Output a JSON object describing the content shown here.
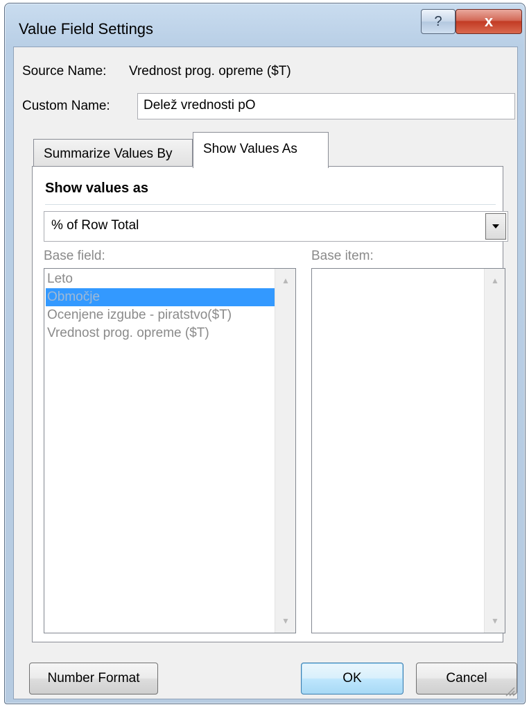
{
  "window": {
    "title": "Value Field Settings",
    "help_glyph": "?",
    "close_glyph": "x"
  },
  "source": {
    "label": "Source Name:",
    "value": "Vrednost prog. opreme ($T)"
  },
  "custom": {
    "label": "Custom Name:",
    "value": "Delež vrednosti pO"
  },
  "tabs": [
    {
      "label": "Summarize Values By",
      "active": false
    },
    {
      "label": "Show Values As",
      "active": true
    }
  ],
  "panel": {
    "section_title": "Show values as",
    "show_values_selected": "% of Row Total",
    "base_field_label": "Base field:",
    "base_item_label": "Base item:",
    "base_fields": [
      "Leto",
      "Območje",
      "Ocenjene izgube - piratstvo($T)",
      "Vrednost prog. opreme ($T)"
    ],
    "base_field_selected": "Območje",
    "base_items": []
  },
  "buttons": {
    "number_format": "Number Format",
    "ok": "OK",
    "cancel": "Cancel"
  },
  "icons": {
    "help": "help-icon",
    "close": "close-icon",
    "dropdown": "chevron-down-icon",
    "scroll_up": "scroll-up-arrow-icon",
    "scroll_down": "scroll-down-arrow-icon",
    "resize": "resize-grip-icon"
  },
  "colors": {
    "selection": "#3399ff",
    "titlebar": "#c9dcef",
    "close_button": "#c23b24"
  }
}
